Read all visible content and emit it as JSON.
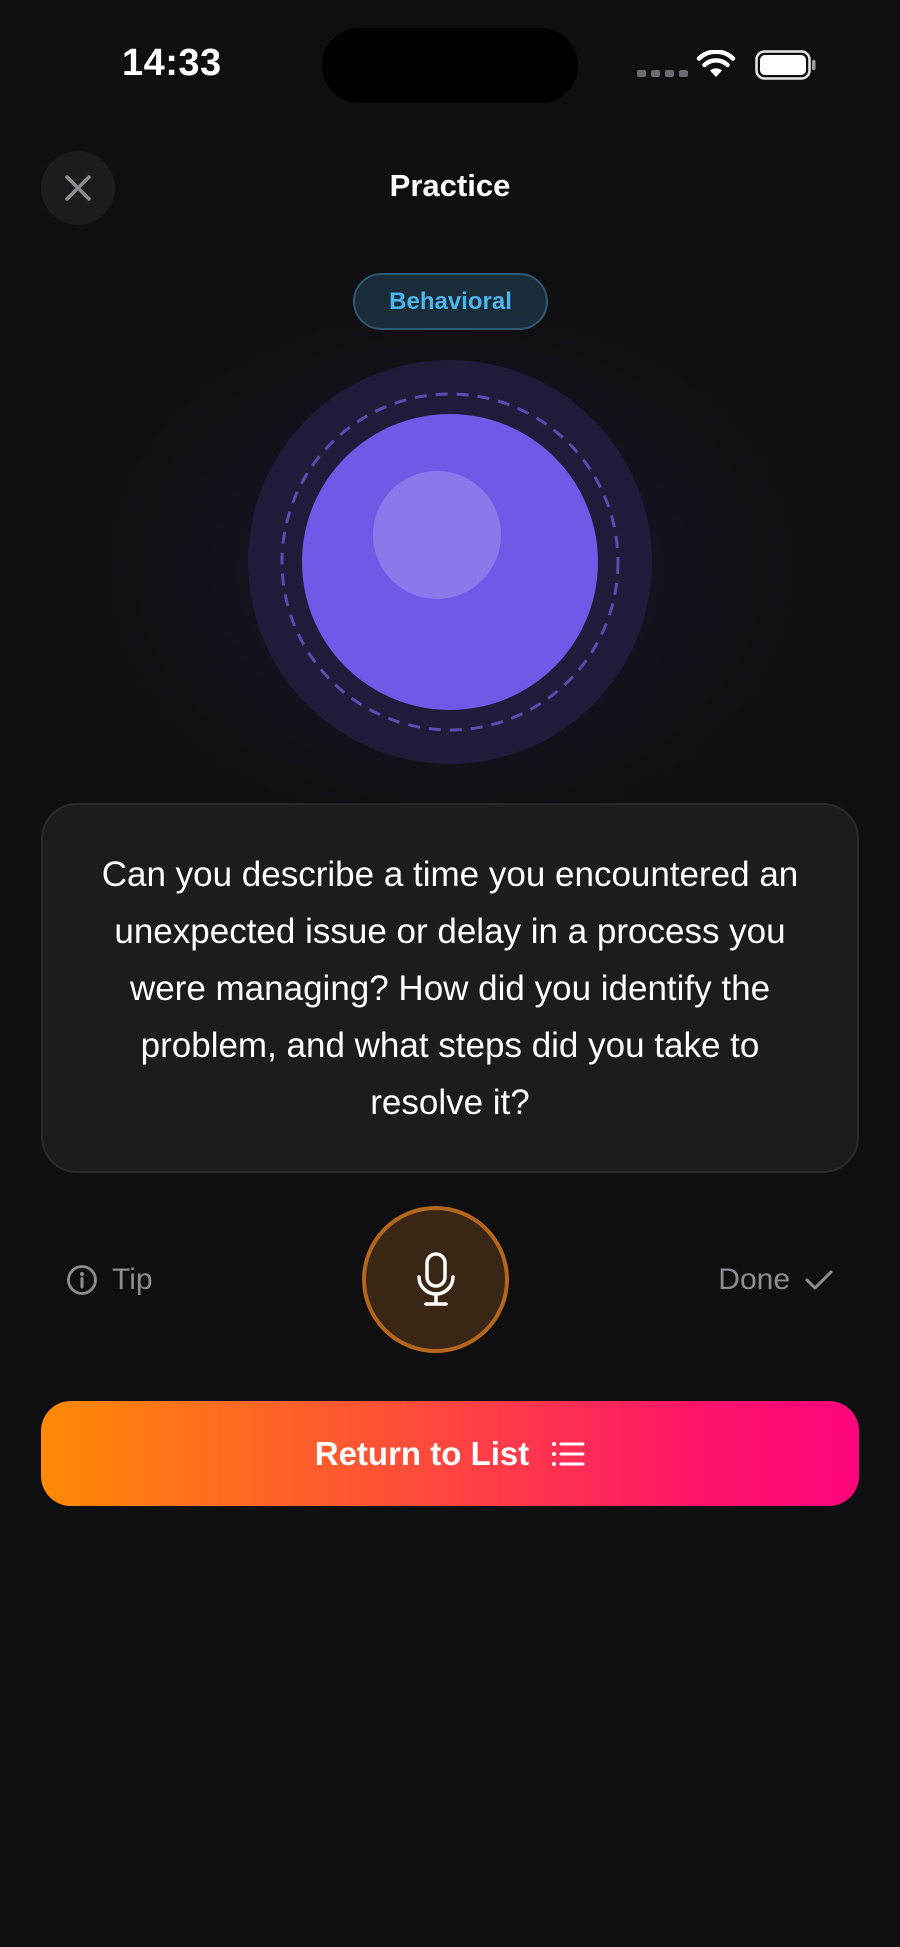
{
  "status_bar": {
    "time": "14:33",
    "icons": [
      "cellular-signal-icon",
      "wifi-icon",
      "battery-icon"
    ]
  },
  "header": {
    "close_icon": "close-icon",
    "title": "Practice"
  },
  "category_badge": "Behavioral",
  "question": {
    "text": "Can you describe a time you encountered an unexpected issue or delay in a process you were managing? How did you identify the problem, and what steps did you take to resolve it?"
  },
  "controls": {
    "tip_label": "Tip",
    "tip_icon": "info-icon",
    "mic_icon": "microphone-icon",
    "done_label": "Done",
    "done_icon": "checkmark-icon"
  },
  "return_button": {
    "label": "Return to List",
    "icon": "list-icon"
  },
  "colors": {
    "background": "#0f0f11",
    "card": "#1c1c1f",
    "orb": "#7059e6",
    "badge_text": "#4db5ee",
    "mic_border": "#b3661c",
    "gradient_start": "#ff8a05",
    "gradient_end": "#ff057e"
  }
}
